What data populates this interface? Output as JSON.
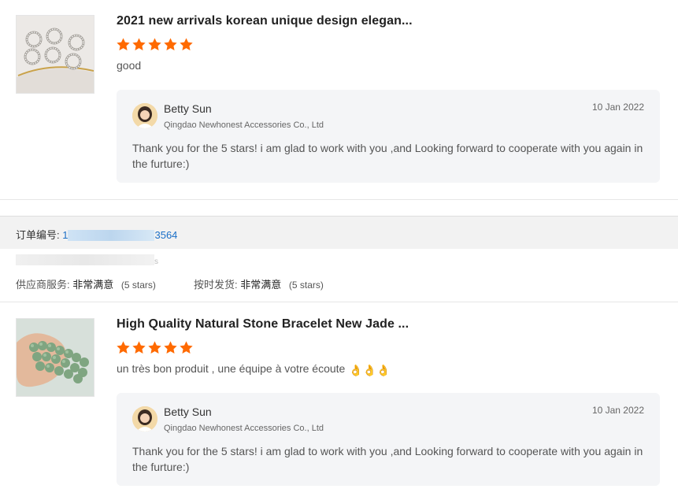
{
  "reviews": [
    {
      "title": "2021 new arrivals korean unique design elegan...",
      "rating": 5,
      "text": "good",
      "emoji": "",
      "image_icon": "rings-product-photo",
      "reply": {
        "name": "Betty Sun",
        "company": "Qingdao Newhonest Accessories Co., Ltd",
        "date": "10 Jan 2022",
        "message": "Thank you for the 5 stars! i am glad to work with you ,and Looking forward to cooperate with you again in the furture:)"
      }
    },
    {
      "title": "High Quality Natural Stone Bracelet New Jade ...",
      "rating": 5,
      "text": "un très bon produit , une équipe à votre écoute",
      "emoji": "👌👌👌",
      "image_icon": "jade-bracelet-photo",
      "reply": {
        "name": "Betty Sun",
        "company": "Qingdao Newhonest Accessories Co., Ltd",
        "date": "10 Jan 2022",
        "message": "Thank you for the 5 stars! i am glad to work with you ,and Looking forward to cooperate with you again in the furture:)"
      }
    }
  ],
  "order": {
    "label": "订单编号:",
    "number_prefix": "1",
    "number_suffix": "3564",
    "buyer_tail": "s"
  },
  "ratings": {
    "supplier_service_label": "供应商服务:",
    "supplier_service_value": "非常满意",
    "supplier_service_stars": "(5 stars)",
    "ontime_label": "按时发货:",
    "ontime_value": "非常满意",
    "ontime_stars": "(5 stars)"
  },
  "colors": {
    "star": "#ff6a00",
    "link": "#1a6fc7",
    "reply_bg": "#f4f5f7",
    "order_bar_bg": "#f2f2f2"
  }
}
